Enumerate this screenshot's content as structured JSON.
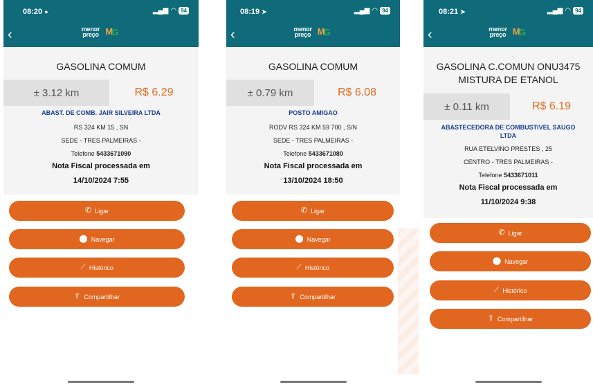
{
  "common": {
    "back_glyph": "‹",
    "brand_line1": "menor",
    "brand_line2": "preço",
    "logo_m": "M",
    "logo_g": "G",
    "signal": "▂▄▆",
    "wifi": "◠",
    "battery": "94",
    "buttons": {
      "call": "Ligar",
      "navigate": "Navegar",
      "history": "Histórico",
      "share": "Compartilhar"
    },
    "icons": {
      "call": "phone-icon",
      "navigate": "location-pin-icon",
      "history": "chart-line-icon",
      "share": "share-icon"
    },
    "colors": {
      "header": "#0f6b7a",
      "price": "#e36a1f",
      "button": "#e1661f",
      "station_name": "#1a3d8f"
    }
  },
  "screens": [
    {
      "time": "08:20",
      "time_symbol": "●",
      "product": "GASOLINA COMUM",
      "product_line2": "",
      "distance": "± 3.12 km",
      "price": "R$ 6.29",
      "station_line1": "ABAST. DE COMB. JAIR SILVEIRA LTDA",
      "station_line2": "",
      "address": "RS 324 KM 15 , SN",
      "district": "SEDE - TRES PALMEIRAS -",
      "phone_label": "Telefone ",
      "phone": "5433671090",
      "nota_label": "Nota Fiscal processada em",
      "nota_datetime": "14/10/2024 7:55"
    },
    {
      "time": "08:19",
      "time_symbol": "➤",
      "product": "GASOLINA COMUM",
      "product_line2": "",
      "distance": "± 0.79 km",
      "price": "R$ 6.08",
      "station_line1": "POSTO AMIGAO",
      "station_line2": "",
      "address": "RODV RS 324 KM 59 700 , S/N",
      "district": "SEDE - TRES PALMEIRAS -",
      "phone_label": "Telefone ",
      "phone": "5433671080",
      "nota_label": "Nota Fiscal processada em",
      "nota_datetime": "13/10/2024 18:50"
    },
    {
      "time": "08:21",
      "time_symbol": "➤",
      "product": "GASOLINA C.COMUN ONU3475",
      "product_line2": "MISTURA DE ETANOL",
      "distance": "± 0.11 km",
      "price": "R$ 6.19",
      "station_line1": "ABASTECEDORA DE COMBUSTIVEL SAUGO",
      "station_line2": "LTDA",
      "address": "RUA ETELVINO PRESTES , 25",
      "district": "CENTRO - TRES PALMEIRAS -",
      "phone_label": "Telefone ",
      "phone": "5433671011",
      "nota_label": "Nota Fiscal processada em",
      "nota_datetime": "11/10/2024 9:38"
    }
  ]
}
